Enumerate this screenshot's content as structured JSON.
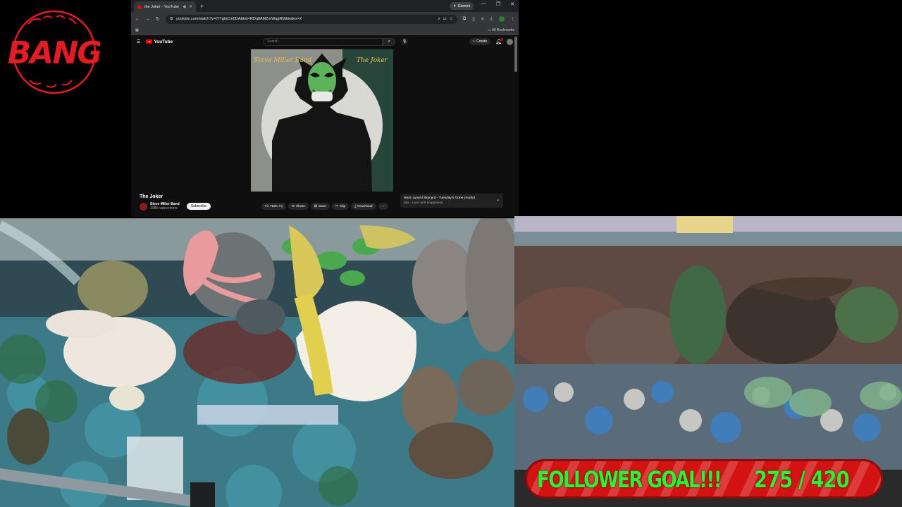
{
  "logo": {
    "text": "BANG",
    "color": "#e31b23"
  },
  "browser": {
    "tab_title": "the Joker - YouTube",
    "new_tab_icon": "plus-icon",
    "gemini_label": "Gemini",
    "url": "youtube.com/watch?v=tYTgtsCm0DA&list=RDq8AMZmWqgRM&index=2",
    "all_bookmarks": "All Bookmarks"
  },
  "youtube": {
    "logo_text": "YouTube",
    "search_placeholder": "Search",
    "create_label": "Create",
    "video_title": "The Joker",
    "channel_name": "Steve Miller Band",
    "subscribers": "308K subscribers",
    "subscribe_label": "Subscribe",
    "likes": "762K",
    "share_label": "Share",
    "save_label": "Save",
    "clip_label": "Clip",
    "download_label": "Download",
    "next_label": "Next: Lynyrd Skynyrd - Tuesday's Gone (Audio)",
    "mix_label": "Mix - Love and Happiness",
    "album_band_text": "Steve Miller Band",
    "album_title_text": "The Joker"
  },
  "goal": {
    "label": "FOLLOWER GOAL!!!",
    "current": 275,
    "target": 420,
    "display": "275 / 420",
    "bar_color": "#d31212",
    "text_color": "#2cf031"
  }
}
